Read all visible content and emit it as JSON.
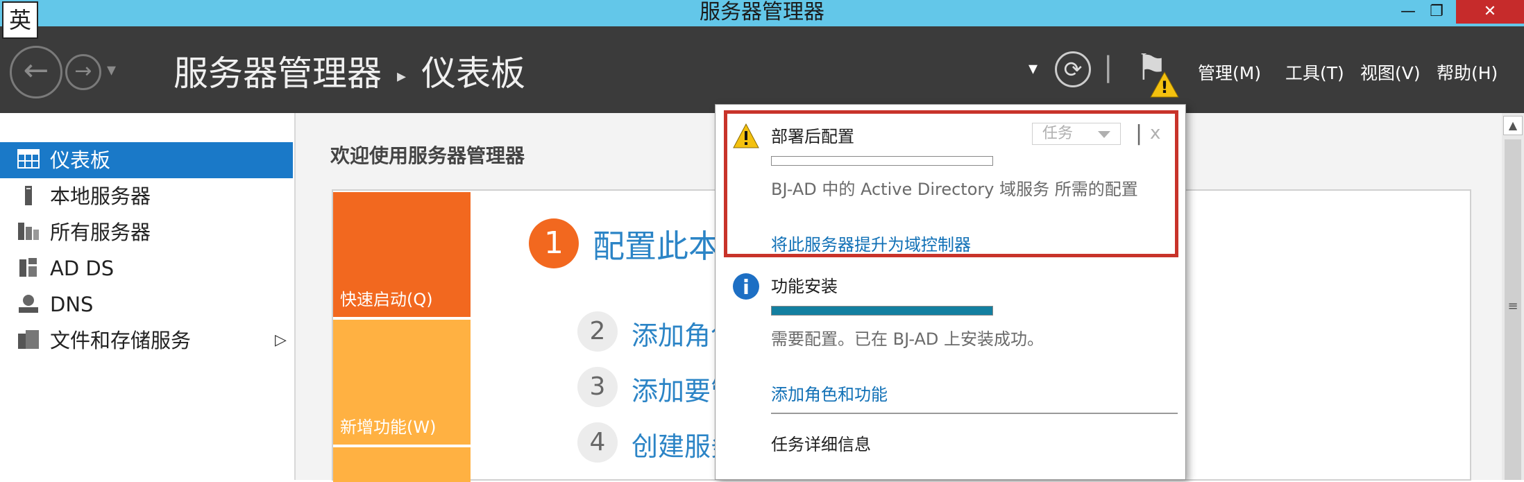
{
  "ime": {
    "label": "英"
  },
  "window": {
    "title": "服务器管理器",
    "minimize": "—",
    "restore": "❐",
    "close": "✕"
  },
  "toolbar": {
    "back_icon": "←",
    "forward_icon": "→",
    "history_icon": "▾",
    "breadcrumb": {
      "root": "服务器管理器",
      "separator": "▸",
      "current": "仪表板"
    },
    "refresh_dropdown_icon": "▾",
    "refresh_icon": "⟳",
    "divider": "|",
    "flag_icon": "⚑",
    "warning_icon": "!",
    "menus": [
      "管理(M)",
      "工具(T)",
      "视图(V)",
      "帮助(H)"
    ]
  },
  "sidebar": {
    "items": [
      {
        "label": "仪表板",
        "icon": "dashboard-icon",
        "active": true
      },
      {
        "label": "本地服务器",
        "icon": "server-icon"
      },
      {
        "label": "所有服务器",
        "icon": "servers-icon"
      },
      {
        "label": "AD DS",
        "icon": "adds-icon"
      },
      {
        "label": "DNS",
        "icon": "dns-icon"
      },
      {
        "label": "文件和存储服务",
        "icon": "storage-icon",
        "expand": "▷"
      }
    ]
  },
  "main": {
    "welcome": "欢迎使用服务器管理器",
    "tiles": [
      "快速启动(Q)",
      "新增功能(W)"
    ],
    "steps": [
      {
        "num": "1",
        "text": "配置此本"
      },
      {
        "num": "2",
        "text": "添加角色"
      },
      {
        "num": "3",
        "text": "添加要管"
      },
      {
        "num": "4",
        "text": "创建服务"
      }
    ]
  },
  "scrollbar": {
    "up": "▲",
    "grip": "≡"
  },
  "popup": {
    "notifications": [
      {
        "title": "部署后配置",
        "task_button": "任务",
        "close": "x",
        "progress": 0,
        "description": "BJ-AD 中的 Active Directory 域服务 所需的配置",
        "link": "将此服务器提升为域控制器"
      },
      {
        "title": "功能安装",
        "progress": 1.0,
        "description": "需要配置。已在 BJ-AD 上安装成功。",
        "link": "添加角色和功能"
      }
    ],
    "footer_link": "任务详细信息"
  },
  "colors": {
    "titlebar": "#63c7e9",
    "toolbar": "#3b3b3b",
    "sidebar_active": "#1a79c8",
    "tile_quickstart": "#f2681f",
    "tile_whatsnew": "#ffb142",
    "highlight_border": "#c8332a",
    "link": "#1070b6",
    "progress_fill": "#137fa0"
  }
}
